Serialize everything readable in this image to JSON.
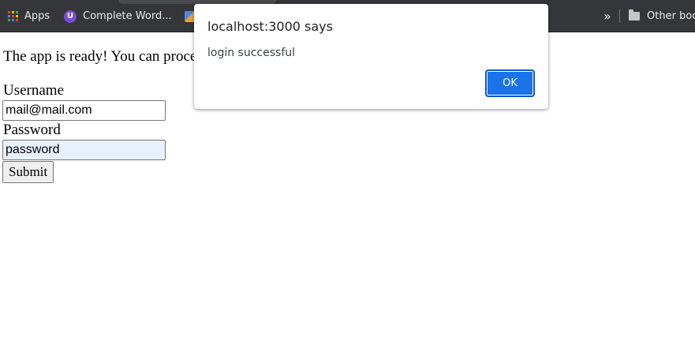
{
  "bookmarks": {
    "apps_label": "Apps",
    "item2_label": "Complete Word...",
    "overflow_glyph": "»",
    "other_label": "Other boo"
  },
  "page": {
    "ready_text": "The app is ready! You can proceed to making changes to your source code starting here.",
    "username_label": "Username",
    "username_value": "mail@mail.com",
    "password_label": "Password",
    "password_value": "password",
    "submit_label": "Submit"
  },
  "dialog": {
    "title": "localhost:3000 says",
    "message": "login successful",
    "ok_label": "OK"
  },
  "colors": {
    "toolbar_bg": "#35363a",
    "accent": "#1a73e8",
    "autofill_bg": "#e8f0fe"
  }
}
